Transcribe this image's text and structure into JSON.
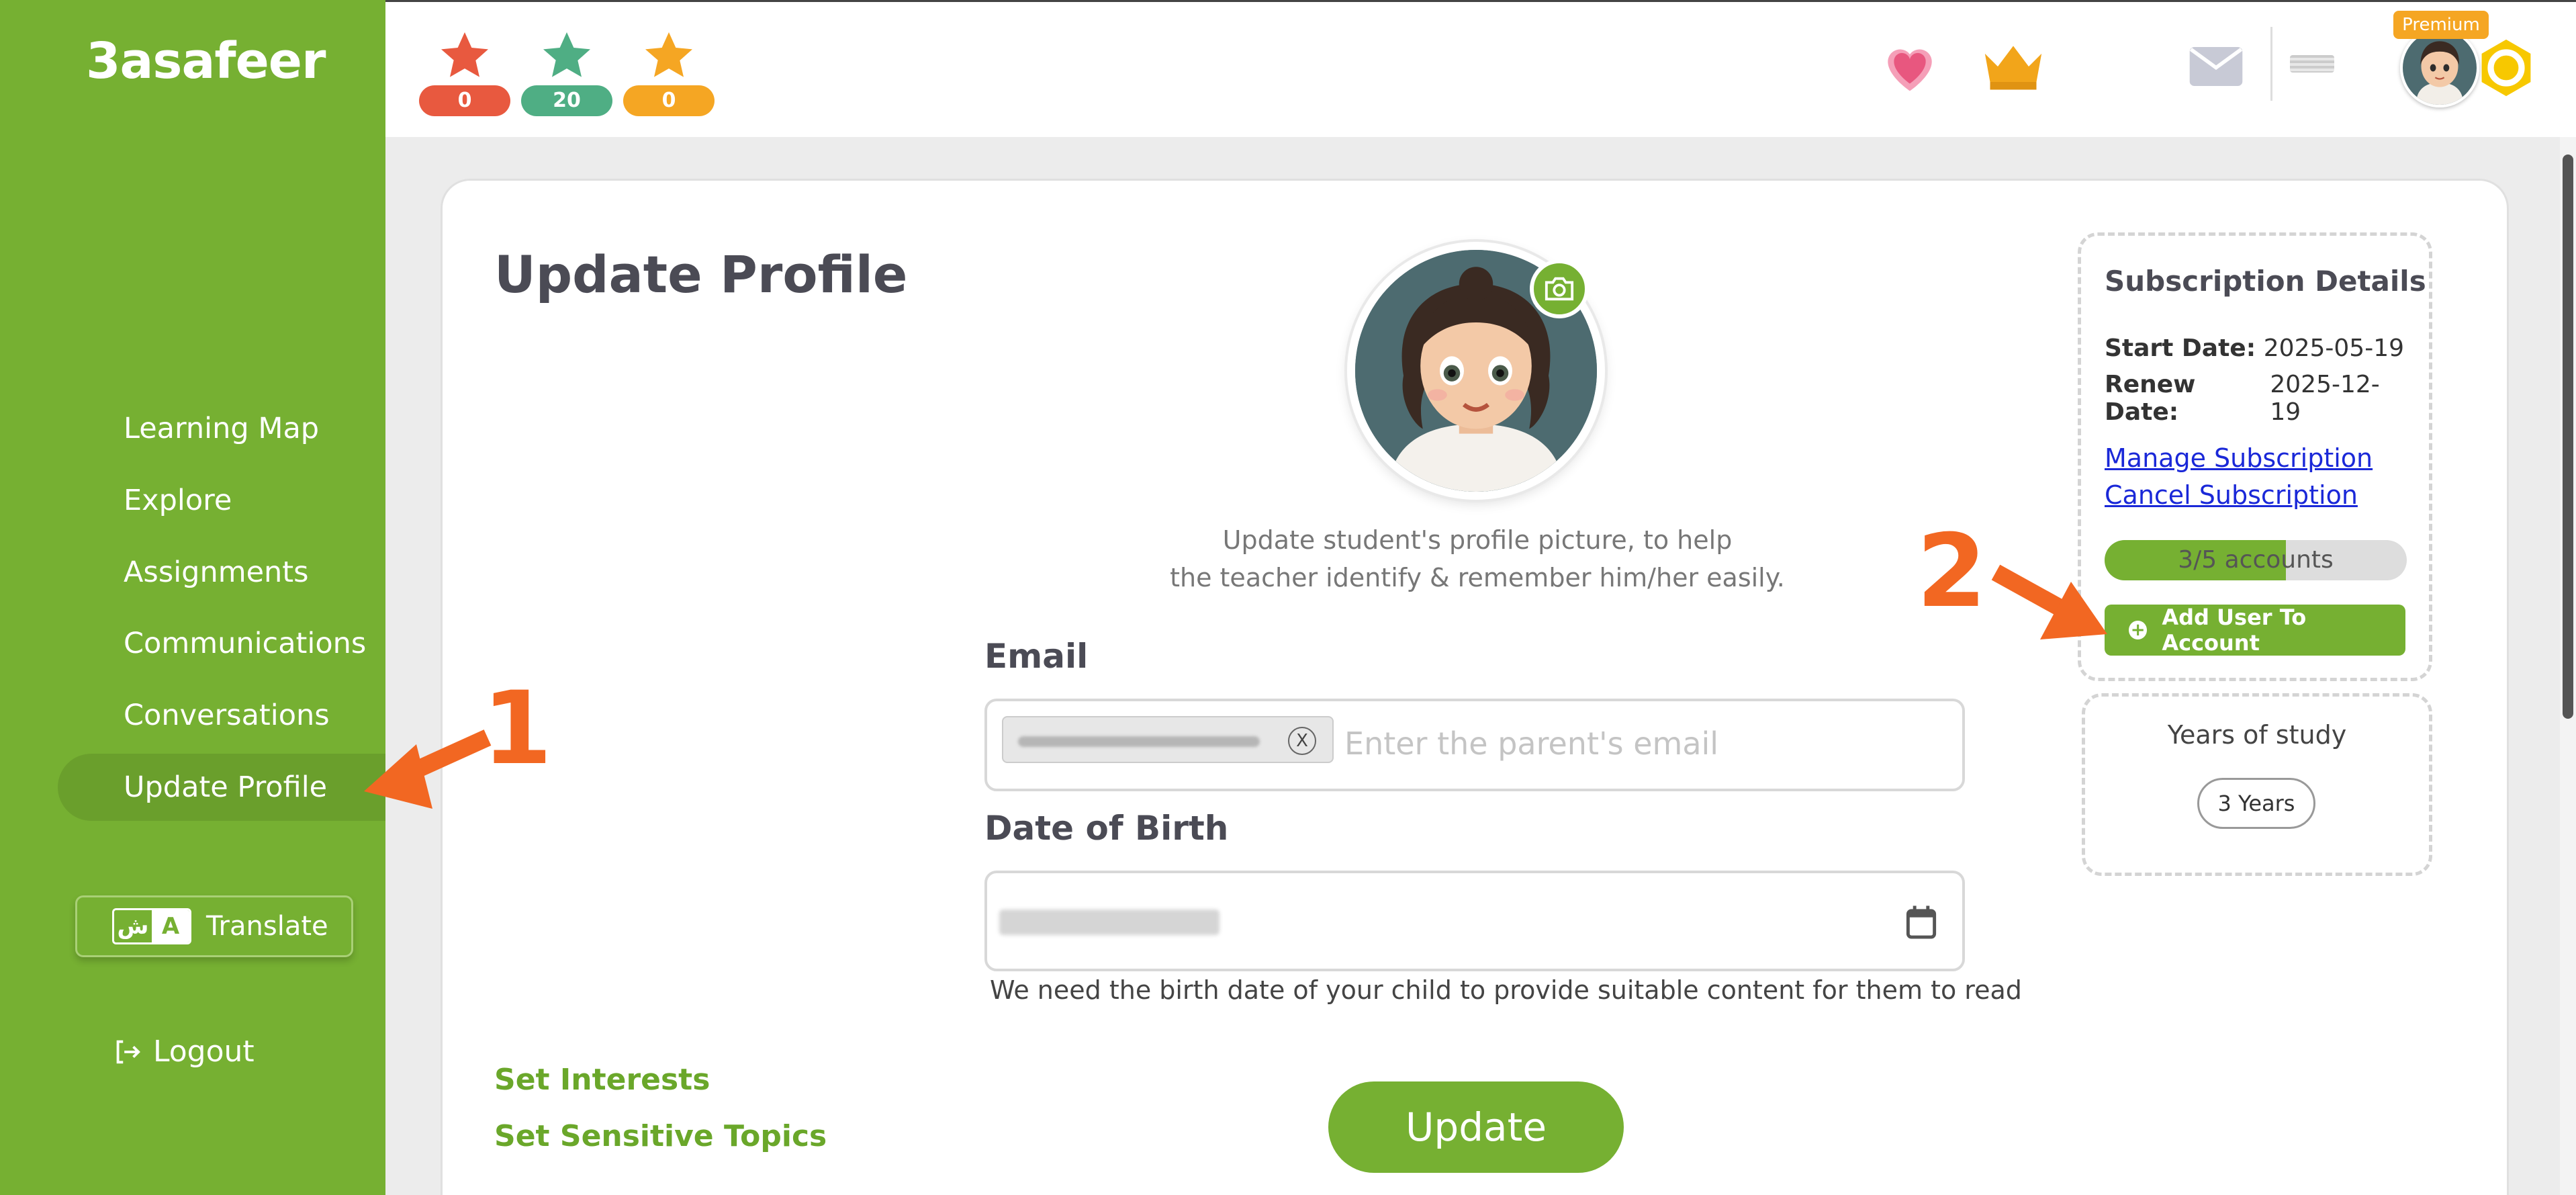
{
  "app": {
    "logo": "3asafeer"
  },
  "sidebar": {
    "items": [
      {
        "label": "Learning Map"
      },
      {
        "label": "Explore"
      },
      {
        "label": "Assignments"
      },
      {
        "label": "Communications"
      },
      {
        "label": "Conversations"
      },
      {
        "label": "Update Profile",
        "active": true
      }
    ],
    "translate": {
      "arabic_glyph": "ش",
      "latin_glyph": "A",
      "label": "Translate"
    },
    "logout_label": "Logout"
  },
  "header": {
    "stars": [
      {
        "color": "#e8593f",
        "count": "0",
        "icon": "red-star-icon"
      },
      {
        "color": "#4fae84",
        "count": "20",
        "icon": "green-star-icon"
      },
      {
        "color": "#f5a623",
        "count": "0",
        "icon": "orange-star-icon"
      }
    ],
    "icons": [
      "heart-icon",
      "crown-icon",
      "coin-icon",
      "mail-icon"
    ],
    "premium_badge": "Premium"
  },
  "main": {
    "title": "Update Profile",
    "picture_help": [
      "Update student's profile picture, to help",
      "the teacher identify & remember him/her easily."
    ],
    "email": {
      "label": "Email",
      "chip_remove": "X",
      "placeholder": "Enter the parent's email"
    },
    "dob": {
      "label": "Date of Birth",
      "note": "We need the birth date of your child to provide suitable content for them to read"
    },
    "links": {
      "interests": "Set Interests",
      "sensitive": "Set Sensitive Topics"
    },
    "update_label": "Update"
  },
  "subscription": {
    "title": "Subscription Details",
    "start_label": "Start Date:",
    "start_value": "2025-05-19",
    "renew_label": "Renew Date:",
    "renew_value": "2025-12-19",
    "manage_label": "Manage Subscription",
    "cancel_label": "Cancel Subscription",
    "accounts_text": "3/5 accounts",
    "accounts_fraction": 0.6,
    "add_user_label": "Add User To Account"
  },
  "years": {
    "label": "Years of study",
    "value": "3 Years"
  },
  "annotations": {
    "one": "1",
    "two": "2",
    "color": "#f26722"
  },
  "colors": {
    "brand_green": "#76b032",
    "link_blue": "#1a28d8"
  }
}
